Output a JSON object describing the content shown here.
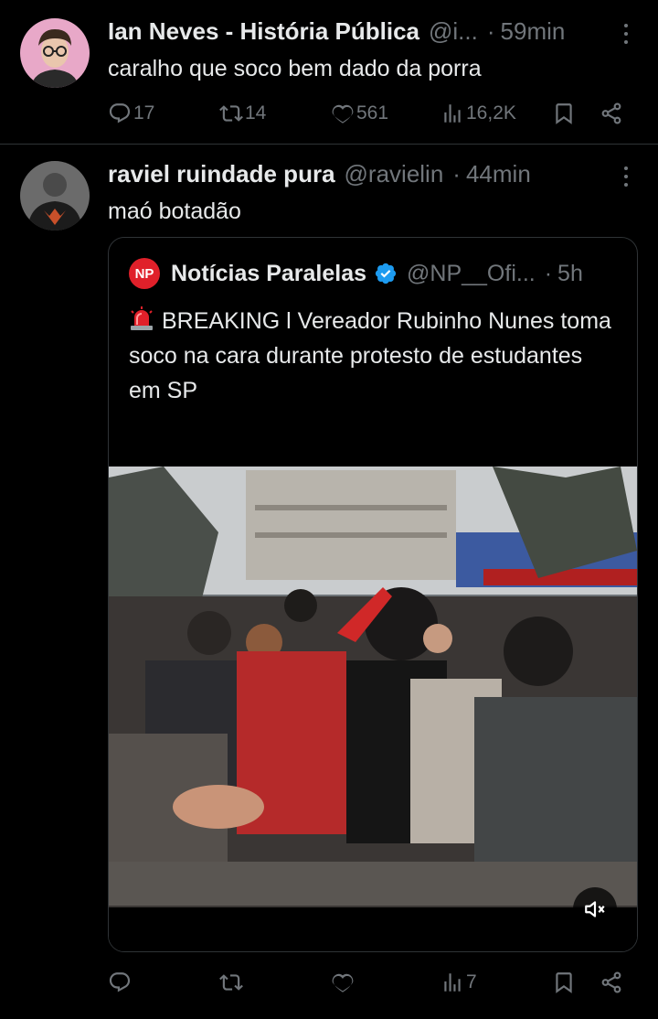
{
  "tweets": [
    {
      "author": "Ian Neves - História Pública",
      "handle": "@i...",
      "time": "59min",
      "text": "caralho que soco bem dado da porra",
      "replies": "17",
      "retweets": "14",
      "likes": "561",
      "views": "16,2K"
    },
    {
      "author": "raviel ruindade pura",
      "handle": "@ravielin",
      "time": "44min",
      "text": "maó botadão",
      "replies": "",
      "retweets": "",
      "likes": "",
      "views": "7",
      "quote": {
        "logo": "NP",
        "author": "Notícias Paralelas",
        "handle": "@NP__Ofi...",
        "time": "5h",
        "text": "BREAKING l Vereador Rubinho Nunes toma soco na cara durante protesto de estudantes em SP"
      }
    }
  ],
  "colors": {
    "background": "#000000",
    "text": "#e7e9ea",
    "muted": "#71767b",
    "border": "#2f3336",
    "verified": "#1d9bf0",
    "logo": "#e0202a"
  },
  "icons": [
    "reply-icon",
    "retweet-icon",
    "like-icon",
    "views-icon",
    "bookmark-icon",
    "share-icon",
    "more-icon",
    "verified-icon",
    "siren-icon",
    "mute-icon"
  ]
}
